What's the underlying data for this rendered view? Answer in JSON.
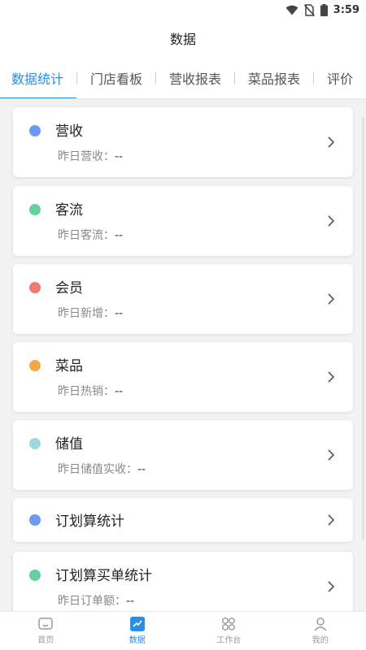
{
  "status": {
    "time": "3:59"
  },
  "header": {
    "title": "数据"
  },
  "tabs": [
    {
      "label": "数据统计",
      "active": true
    },
    {
      "label": "门店看板"
    },
    {
      "label": "营收报表"
    },
    {
      "label": "菜品报表"
    },
    {
      "label": "评价"
    }
  ],
  "cards": [
    {
      "title": "营收",
      "sub_label": "昨日营收：",
      "sub_value": "--",
      "dot_color": "#6b9af0"
    },
    {
      "title": "客流",
      "sub_label": "昨日客流：",
      "sub_value": "--",
      "dot_color": "#68cf9c"
    },
    {
      "title": "会员",
      "sub_label": "昨日新增：",
      "sub_value": "--",
      "dot_color": "#ef7a72"
    },
    {
      "title": "菜品",
      "sub_label": "昨日热销：",
      "sub_value": "--",
      "dot_color": "#f3a94a"
    },
    {
      "title": "储值",
      "sub_label": "昨日储值实收：",
      "sub_value": "--",
      "dot_color": "#9ed7dd"
    },
    {
      "title": "订划算统计",
      "dot_color": "#6b9af0"
    },
    {
      "title": "订划算买单统计",
      "sub_label": "昨日订单额：",
      "sub_value": "--",
      "dot_color": "#68cf9c"
    }
  ],
  "bottom_nav": [
    {
      "label": "首页",
      "icon": "home-icon"
    },
    {
      "label": "数据",
      "icon": "chart-icon",
      "active": true
    },
    {
      "label": "工作台",
      "icon": "grid-icon"
    },
    {
      "label": "我的",
      "icon": "person-icon"
    }
  ],
  "colors": {
    "accent": "#2a8ee6"
  }
}
